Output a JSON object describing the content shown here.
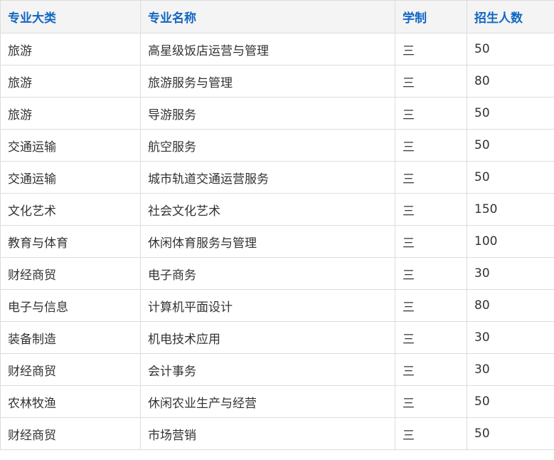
{
  "table": {
    "headers": [
      "专业大类",
      "专业名称",
      "学制",
      "招生人数"
    ],
    "rows": [
      [
        "旅游",
        "高星级饭店运营与管理",
        "三",
        "50"
      ],
      [
        "旅游",
        "旅游服务与管理",
        "三",
        "80"
      ],
      [
        "旅游",
        "导游服务",
        "三",
        "50"
      ],
      [
        "交通运输",
        "航空服务",
        "三",
        "50"
      ],
      [
        "交通运输",
        "城市轨道交通运营服务",
        "三",
        "50"
      ],
      [
        "文化艺术",
        "社会文化艺术",
        "三",
        "150"
      ],
      [
        "教育与体育",
        "休闲体育服务与管理",
        "三",
        "100"
      ],
      [
        "财经商贸",
        "电子商务",
        "三",
        "30"
      ],
      [
        "电子与信息",
        "计算机平面设计",
        "三",
        "80"
      ],
      [
        "装备制造",
        "机电技术应用",
        "三",
        "30"
      ],
      [
        "财经商贸",
        "会计事务",
        "三",
        "30"
      ],
      [
        "农林牧渔",
        "休闲农业生产与经营",
        "三",
        "50"
      ],
      [
        "财经商贸",
        "市场营销",
        "三",
        "50"
      ]
    ]
  },
  "colors": {
    "header_text": "#1266c2",
    "header_bg": "#f4f4f4",
    "border": "#dcdcdc",
    "body_text": "#333333"
  }
}
